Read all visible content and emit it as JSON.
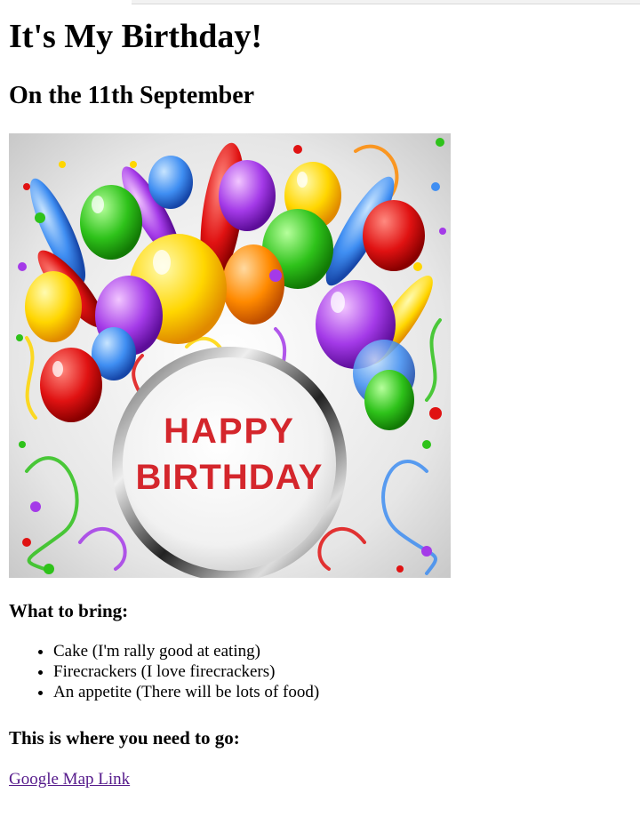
{
  "heading": "It's My Birthday!",
  "subheading": "On the 11th September",
  "banner": {
    "line1": "HAPPY",
    "line2": "BIRTHDAY"
  },
  "bring_heading": "What to bring:",
  "bring_items": [
    "Cake (I'm rally good at eating)",
    "Firecrackers (I love firecrackers)",
    "An appetite (There will be lots of food)"
  ],
  "go_heading": "This is where you need to go:",
  "map_link": "Google Map Link",
  "colors": {
    "link": "#551a8b",
    "banner_text": "#d4262c"
  }
}
